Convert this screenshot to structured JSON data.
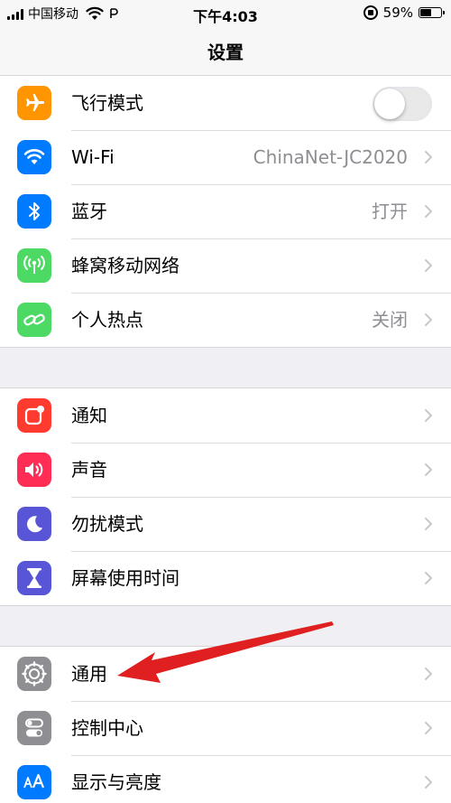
{
  "status_bar": {
    "carrier": "中国移动",
    "time": "下午4:03",
    "battery_percent_label": "59%",
    "battery_level": 0.59
  },
  "nav": {
    "title": "设置"
  },
  "groups": [
    {
      "rows": [
        {
          "label": "飞行模式",
          "icon": "airplane-icon",
          "color": "#ff9500",
          "toggle": true,
          "toggle_on": false
        },
        {
          "label": "Wi-Fi",
          "icon": "wifi-icon",
          "color": "#007aff",
          "detail": "ChinaNet-JC2020"
        },
        {
          "label": "蓝牙",
          "icon": "bluetooth-icon",
          "color": "#007aff",
          "detail": "打开"
        },
        {
          "label": "蜂窝移动网络",
          "icon": "cellular-icon",
          "color": "#4cd964"
        },
        {
          "label": "个人热点",
          "icon": "hotspot-icon",
          "color": "#4cd964",
          "detail": "关闭"
        }
      ]
    },
    {
      "rows": [
        {
          "label": "通知",
          "icon": "notifications-icon",
          "color": "#ff3b30"
        },
        {
          "label": "声音",
          "icon": "sound-icon",
          "color": "#ff2d55"
        },
        {
          "label": "勿扰模式",
          "icon": "moon-icon",
          "color": "#5856d6"
        },
        {
          "label": "屏幕使用时间",
          "icon": "hourglass-icon",
          "color": "#5856d6"
        }
      ]
    },
    {
      "rows": [
        {
          "label": "通用",
          "icon": "gear-icon",
          "color": "#8e8e93"
        },
        {
          "label": "控制中心",
          "icon": "control-center-icon",
          "color": "#8e8e93"
        },
        {
          "label": "显示与亮度",
          "icon": "display-brightness-icon",
          "color": "#007aff"
        }
      ]
    }
  ],
  "annotation": {
    "color": "#e02020",
    "icon": "red-arrow-pointer"
  }
}
